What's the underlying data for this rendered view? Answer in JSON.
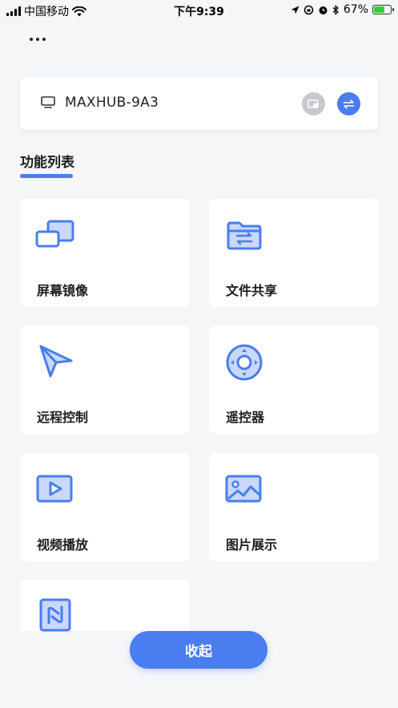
{
  "status_bar": {
    "carrier": "中国移动",
    "time": "下午9:39",
    "battery_percent": "67%",
    "battery_level": 0.67
  },
  "device": {
    "name": "MAXHUB-9A3"
  },
  "section": {
    "title": "功能列表"
  },
  "features": [
    {
      "label": "屏幕镜像",
      "icon": "screen-mirror-icon"
    },
    {
      "label": "文件共享",
      "icon": "file-share-icon"
    },
    {
      "label": "远程控制",
      "icon": "remote-control-icon"
    },
    {
      "label": "遥控器",
      "icon": "remote-dpad-icon"
    },
    {
      "label": "视频播放",
      "icon": "video-play-icon"
    },
    {
      "label": "图片展示",
      "icon": "image-display-icon"
    },
    {
      "label": "",
      "icon": "nfc-icon"
    }
  ],
  "collapse_label": "收起",
  "colors": {
    "accent": "#4a7df0",
    "icon_fill": "#c9d8fb",
    "background": "#f5f6f8"
  }
}
